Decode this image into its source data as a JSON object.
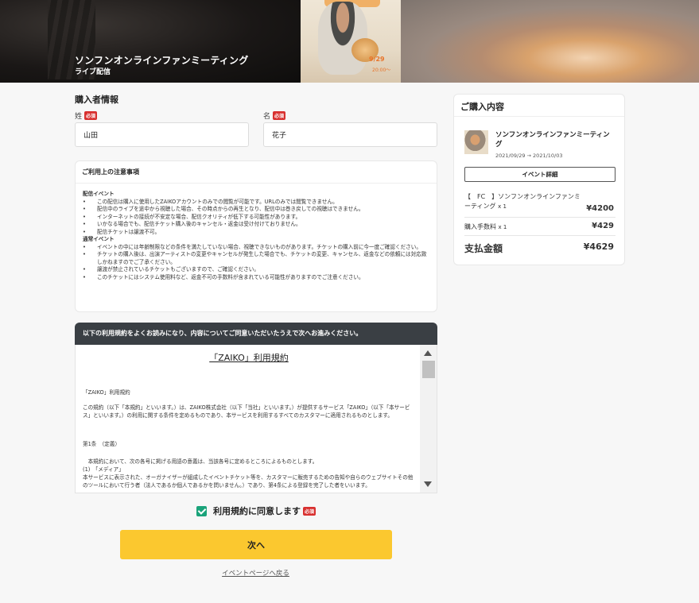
{
  "hero": {
    "title": "ソンフンオンラインファンミーティング",
    "subtitle": "ライブ配信",
    "poster_date": "9/29",
    "poster_time": "20:00〜"
  },
  "buyer": {
    "section_title": "購入者情報",
    "last_name_label": "姓",
    "first_name_label": "名",
    "required_badge": "必須",
    "last_name_value": "山田",
    "first_name_value": "花子"
  },
  "notice": {
    "title": "ご利用上の注意事項",
    "groups": [
      {
        "heading": "配信イベント",
        "items": [
          "この配信は購入に使用したZAIKOアカウントのみでの閲覧が可能です。URLのみでは閲覧できません。",
          "配信中のライブを途中から視聴した場合、その時点からの再生となり、配信中は巻き戻しての視聴はできません。",
          "インターネットの接続が不安定な場合、配信クオリティが低下する可能性があります。",
          "いかなる場合でも、配信チケット購入後のキャンセル・返金は受け付けておりません。",
          "配信チケットは譲渡不可。"
        ]
      },
      {
        "heading": "通常イベント",
        "items": [
          "イベントの中には年齢制限などの条件を満たしていない場合、視聴できないものがあります。チケットの購入前に今一度ご確認ください。",
          "チケットの購入後は、出演アーティストの変更やキャンセルが発生した場合でも、チケットの変更、キャンセル、返金などの依頼には対応致しかねますのでご了承ください。",
          "譲渡が禁止されているチケットもございますので、ご確認ください。",
          "このチケットにはシステム使用料など、返金不可の手数料が含まれている可能性がありますのでご注意ください。"
        ]
      }
    ]
  },
  "terms": {
    "header": "以下の利用規約をよくお読みになり、内容についてご同意いただいたうえで次へお進みください。",
    "doc_title": "「ZAIKO」利用規約",
    "paragraphs": [
      "「ZAIKO」利用規約",
      "この規約（以下「本規約」といいます。）は、ZAIKO株式会社（以下「当社」といいます。）が提供するサービス「ZAIKO」（以下「本サービス」といいます。）の利用に関する条件を定めるものであり、本サービスを利用するすべてのカスタマーに適用されるものとします。",
      "第1条　（定義）",
      "　本規約において、次の各号に掲げる用語の意義は、当該各号に定めるところによるものとします。",
      "(1)　「メディア」",
      "本サービスに表示された、オーガナイザーが組成したイベントチケット等を、カスタマーに販売するための告知や自らのウェブサイトその他のツールにおいて行う者（法人であるか個人であるかを問いません。）であり、第4条による登録を完了した者をいいます。"
    ]
  },
  "agree": {
    "label": "利用規約に同意します",
    "checked": true,
    "required_badge": "必須"
  },
  "actions": {
    "next_label": "次へ",
    "back_link_label": "イベントページへ戻る"
  },
  "summary": {
    "title": "ご購入内容",
    "event_title": "ソンフンオンラインファンミーティング",
    "event_dates": "2021/09/29 → 2021/10/03",
    "detail_button": "イベント詳細",
    "ticket_label": "【　FC　】ソンフンオンラインファンミーティング",
    "ticket_qty": "x 1",
    "ticket_price": "¥4200",
    "fee_label": "購入手数料",
    "fee_qty": "x 1",
    "fee_price": "¥429",
    "total_label": "支払金額",
    "total_price": "¥4629"
  },
  "colors": {
    "accent_yellow": "#fbc82f",
    "check_green": "#1aa37a",
    "required_red": "#d8302f",
    "terms_header_bg": "#3a3f44"
  }
}
